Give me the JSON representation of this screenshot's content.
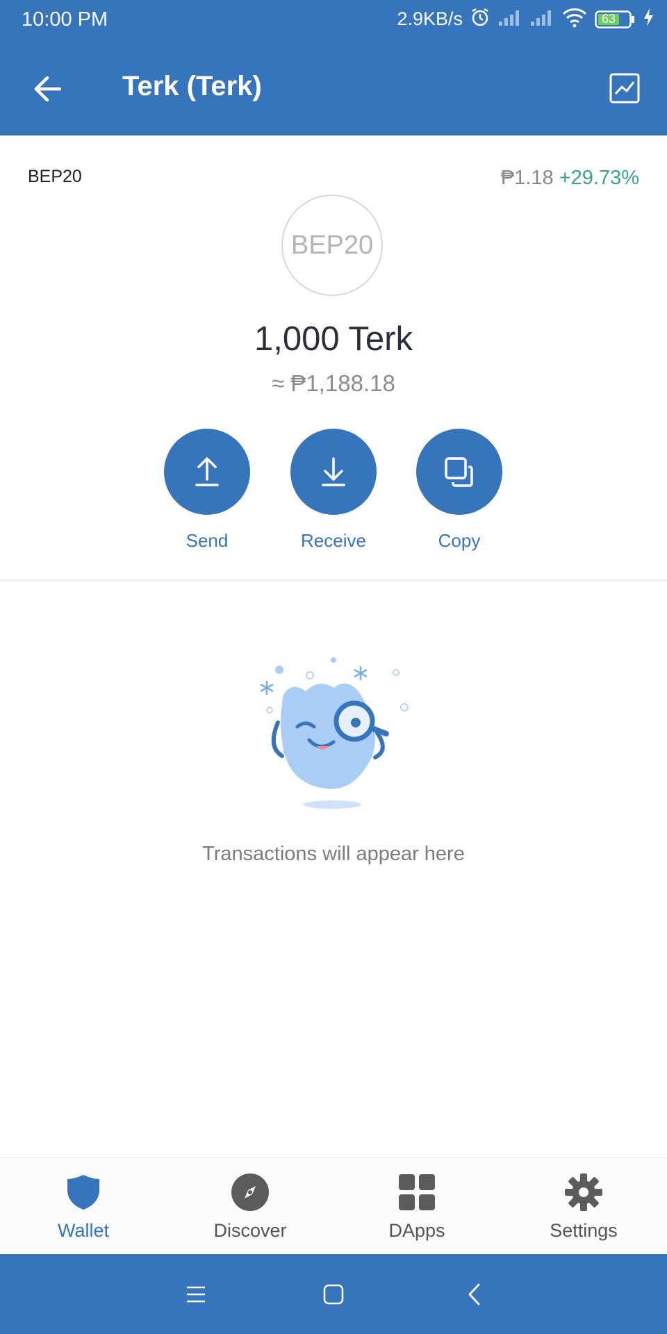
{
  "status_bar": {
    "time": "10:00 PM",
    "network_speed": "2.9KB/s",
    "battery_level": "63"
  },
  "header": {
    "title": "Terk (Terk)",
    "back_icon": "arrow-left-icon",
    "chart_icon": "chart-icon"
  },
  "token": {
    "network": "BEP20",
    "logo_text": "BEP20",
    "price": "₱1.18",
    "price_change": "+29.73%",
    "balance": "1,000 Terk",
    "fiat_value": "≈ ₱1,188.18"
  },
  "actions": [
    {
      "label": "Send",
      "icon": "upload-arrow-icon"
    },
    {
      "label": "Receive",
      "icon": "download-arrow-icon"
    },
    {
      "label": "Copy",
      "icon": "copy-icon"
    }
  ],
  "empty_state": {
    "message": "Transactions will appear here"
  },
  "bottom_nav": {
    "items": [
      {
        "label": "Wallet",
        "icon": "shield-icon",
        "active": true
      },
      {
        "label": "Discover",
        "icon": "compass-icon",
        "active": false
      },
      {
        "label": "DApps",
        "icon": "grid-icon",
        "active": false
      },
      {
        "label": "Settings",
        "icon": "gear-icon",
        "active": false
      }
    ]
  },
  "colors": {
    "primary": "#3675bb",
    "positive": "#3aa586",
    "muted_text": "#8a8a8a"
  }
}
